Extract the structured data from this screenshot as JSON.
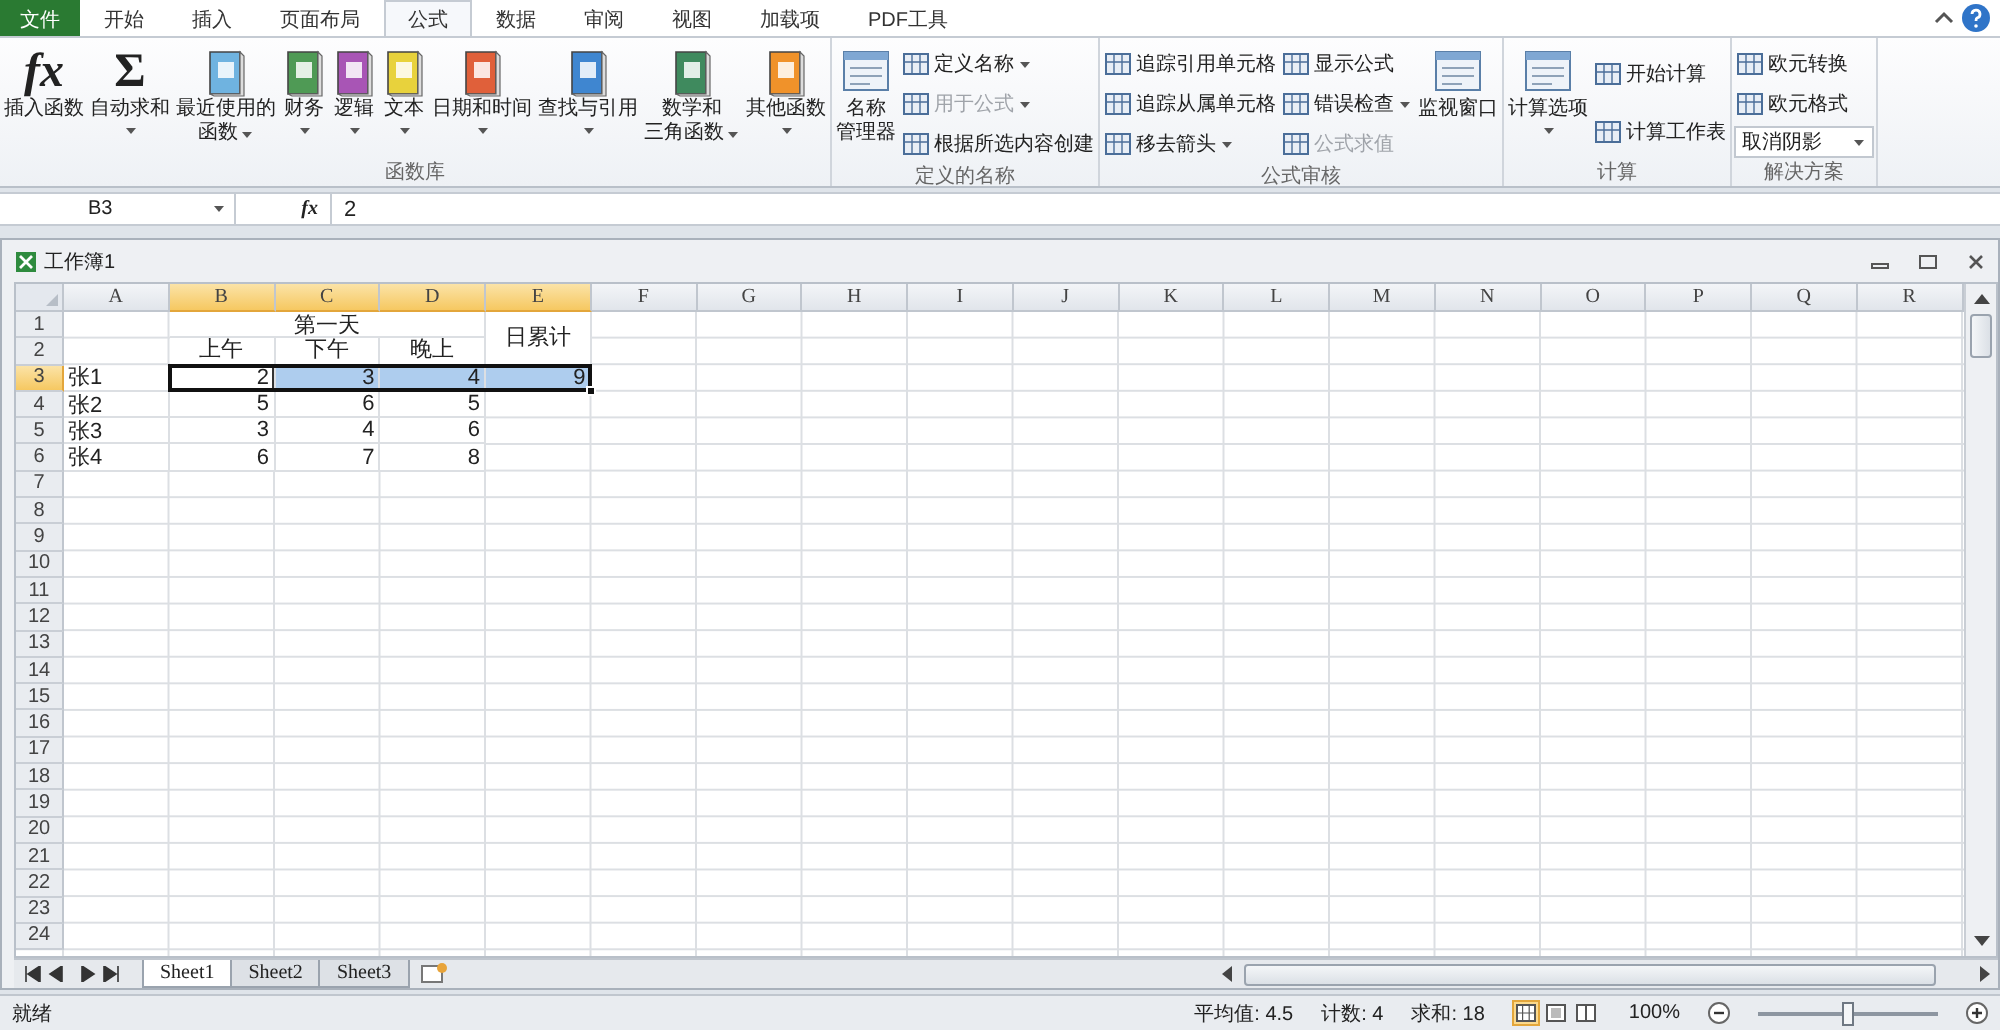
{
  "ribbon_tabs": [
    {
      "label": "文件",
      "kind": "file",
      "selected": false
    },
    {
      "label": "开始",
      "kind": "tab",
      "selected": false
    },
    {
      "label": "插入",
      "kind": "tab",
      "selected": false
    },
    {
      "label": "页面布局",
      "kind": "tab",
      "selected": false
    },
    {
      "label": "公式",
      "kind": "tab",
      "selected": true
    },
    {
      "label": "数据",
      "kind": "tab",
      "selected": false
    },
    {
      "label": "审阅",
      "kind": "tab",
      "selected": false
    },
    {
      "label": "视图",
      "kind": "tab",
      "selected": false
    },
    {
      "label": "加载项",
      "kind": "tab",
      "selected": false
    },
    {
      "label": "PDF工具",
      "kind": "tab",
      "selected": false
    }
  ],
  "ribbon_groups": [
    {
      "label": "函数库",
      "items": [
        {
          "kind": "large",
          "glyph": "fx",
          "lines": [
            "插入函数"
          ],
          "dropdown": false
        },
        {
          "kind": "large",
          "glyph": "Σ",
          "lines": [
            "自动求和"
          ],
          "dropdown": true
        },
        {
          "kind": "large",
          "color": "#6fb3e0",
          "lines": [
            "最近使用的",
            "函数"
          ],
          "dropdown": true
        },
        {
          "kind": "large",
          "color": "#4f9a55",
          "lines": [
            "财务"
          ],
          "dropdown": true
        },
        {
          "kind": "large",
          "color": "#a855b5",
          "lines": [
            "逻辑"
          ],
          "dropdown": true
        },
        {
          "kind": "large",
          "color": "#e8d23c",
          "lines": [
            "文本"
          ],
          "dropdown": true
        },
        {
          "kind": "large",
          "color": "#e0603a",
          "lines": [
            "日期和时间"
          ],
          "dropdown": true
        },
        {
          "kind": "large",
          "color": "#3f86d0",
          "lines": [
            "查找与引用"
          ],
          "dropdown": true
        },
        {
          "kind": "large",
          "color": "#3f8a5e",
          "lines": [
            "数学和",
            "三角函数"
          ],
          "dropdown": true
        },
        {
          "kind": "large",
          "color": "#f0922a",
          "lines": [
            "其他函数"
          ],
          "dropdown": true
        }
      ]
    },
    {
      "label": "定义的名称",
      "items": [
        {
          "kind": "large",
          "lines": [
            "名称",
            "管理器"
          ],
          "dropdown": false
        },
        {
          "kind": "stack",
          "items": [
            {
              "kind": "button",
              "label": "定义名称",
              "dropdown": true,
              "disabled": false
            },
            {
              "kind": "button",
              "label": "用于公式",
              "dropdown": true,
              "disabled": true
            },
            {
              "kind": "button",
              "label": "根据所选内容创建",
              "dropdown": false,
              "disabled": false
            }
          ]
        }
      ]
    },
    {
      "label": "公式审核",
      "items": [
        {
          "kind": "stack",
          "items": [
            {
              "kind": "button",
              "label": "追踪引用单元格",
              "dropdown": false,
              "disabled": false
            },
            {
              "kind": "button",
              "label": "追踪从属单元格",
              "dropdown": false,
              "disabled": false
            },
            {
              "kind": "button",
              "label": "移去箭头",
              "dropdown": true,
              "disabled": false
            }
          ]
        },
        {
          "kind": "stack",
          "items": [
            {
              "kind": "button",
              "label": "显示公式",
              "dropdown": false,
              "disabled": false
            },
            {
              "kind": "button",
              "label": "错误检查",
              "dropdown": true,
              "disabled": false
            },
            {
              "kind": "button",
              "label": "公式求值",
              "dropdown": false,
              "disabled": true
            }
          ]
        },
        {
          "kind": "large",
          "lines": [
            "监视窗口"
          ],
          "dropdown": false
        }
      ]
    },
    {
      "label": "计算",
      "items": [
        {
          "kind": "large",
          "lines": [
            "计算选项"
          ],
          "dropdown": true
        },
        {
          "kind": "stack",
          "items": [
            {
              "kind": "button",
              "label": "开始计算",
              "dropdown": false,
              "disabled": false
            },
            {
              "kind": "button",
              "label": "计算工作表",
              "dropdown": false,
              "disabled": false
            }
          ]
        }
      ]
    },
    {
      "label": "解决方案",
      "items": [
        {
          "kind": "stack",
          "items": [
            {
              "kind": "button",
              "label": "欧元转换",
              "dropdown": false,
              "disabled": false
            },
            {
              "kind": "button",
              "label": "欧元格式",
              "dropdown": false,
              "disabled": false
            },
            {
              "kind": "select",
              "label": "取消阴影",
              "dropdown": true,
              "disabled": false
            }
          ]
        }
      ]
    }
  ],
  "formula_bar": {
    "name_box": "B3",
    "fx": "fx",
    "formula": "2"
  },
  "workbook": {
    "title": "工作簿1"
  },
  "sheet": {
    "columns": [
      {
        "label": "A",
        "selected": false
      },
      {
        "label": "B",
        "selected": true
      },
      {
        "label": "C",
        "selected": true
      },
      {
        "label": "D",
        "selected": true
      },
      {
        "label": "E",
        "selected": true
      },
      {
        "label": "F",
        "selected": false
      },
      {
        "label": "G",
        "selected": false
      },
      {
        "label": "H",
        "selected": false
      },
      {
        "label": "I",
        "selected": false
      },
      {
        "label": "J",
        "selected": false
      },
      {
        "label": "K",
        "selected": false
      },
      {
        "label": "L",
        "selected": false
      },
      {
        "label": "M",
        "selected": false
      },
      {
        "label": "N",
        "selected": false
      },
      {
        "label": "O",
        "selected": false
      },
      {
        "label": "P",
        "selected": false
      },
      {
        "label": "Q",
        "selected": false
      },
      {
        "label": "R",
        "selected": false
      }
    ],
    "row_numbers": [
      {
        "label": "1",
        "selected": false
      },
      {
        "label": "2",
        "selected": false
      },
      {
        "label": "3",
        "selected": true
      },
      {
        "label": "4",
        "selected": false
      },
      {
        "label": "5",
        "selected": false
      },
      {
        "label": "6",
        "selected": false
      },
      {
        "label": "7",
        "selected": false
      },
      {
        "label": "8",
        "selected": false
      },
      {
        "label": "9",
        "selected": false
      },
      {
        "label": "10",
        "selected": false
      },
      {
        "label": "11",
        "selected": false
      },
      {
        "label": "12",
        "selected": false
      },
      {
        "label": "13",
        "selected": false
      },
      {
        "label": "14",
        "selected": false
      },
      {
        "label": "15",
        "selected": false
      },
      {
        "label": "16",
        "selected": false
      },
      {
        "label": "17",
        "selected": false
      },
      {
        "label": "18",
        "selected": false
      },
      {
        "label": "19",
        "selected": false
      },
      {
        "label": "20",
        "selected": false
      },
      {
        "label": "21",
        "selected": false
      },
      {
        "label": "22",
        "selected": false
      },
      {
        "label": "23",
        "selected": false
      },
      {
        "label": "24",
        "selected": false
      }
    ],
    "header": {
      "group": "第一天",
      "subheaders": [
        "上午",
        "下午",
        "晚上"
      ],
      "total": "日累计"
    },
    "rows": [
      {
        "cells": [
          {
            "text": "张1",
            "selected": false,
            "active": false
          },
          {
            "text": "2",
            "selected": true,
            "active": true
          },
          {
            "text": "3",
            "selected": true,
            "active": false
          },
          {
            "text": "4",
            "selected": true,
            "active": false
          },
          {
            "text": "9",
            "selected": true,
            "active": false
          }
        ]
      },
      {
        "cells": [
          {
            "text": "张2",
            "selected": false,
            "active": false
          },
          {
            "text": "5",
            "selected": false,
            "active": false
          },
          {
            "text": "6",
            "selected": false,
            "active": false
          },
          {
            "text": "5",
            "selected": false,
            "active": false
          }
        ]
      },
      {
        "cells": [
          {
            "text": "张3",
            "selected": false,
            "active": false
          },
          {
            "text": "3",
            "selected": false,
            "active": false
          },
          {
            "text": "4",
            "selected": false,
            "active": false
          },
          {
            "text": "6",
            "selected": false,
            "active": false
          }
        ]
      },
      {
        "cells": [
          {
            "text": "张4",
            "selected": false,
            "active": false
          },
          {
            "text": "6",
            "selected": false,
            "active": false
          },
          {
            "text": "7",
            "selected": false,
            "active": false
          },
          {
            "text": "8",
            "selected": false,
            "active": false
          }
        ]
      }
    ]
  },
  "sheet_tabs": [
    {
      "label": "Sheet1",
      "selected": true
    },
    {
      "label": "Sheet2",
      "selected": false
    },
    {
      "label": "Sheet3",
      "selected": false
    }
  ],
  "status_bar": {
    "status": "就绪",
    "average": "平均值: 4.5",
    "count": "计数: 4",
    "sum": "求和: 18",
    "views": [
      {
        "selected": true
      },
      {
        "selected": false
      },
      {
        "selected": false
      }
    ],
    "zoom": "100%",
    "zoom_slider": {
      "level": 0.5
    }
  }
}
